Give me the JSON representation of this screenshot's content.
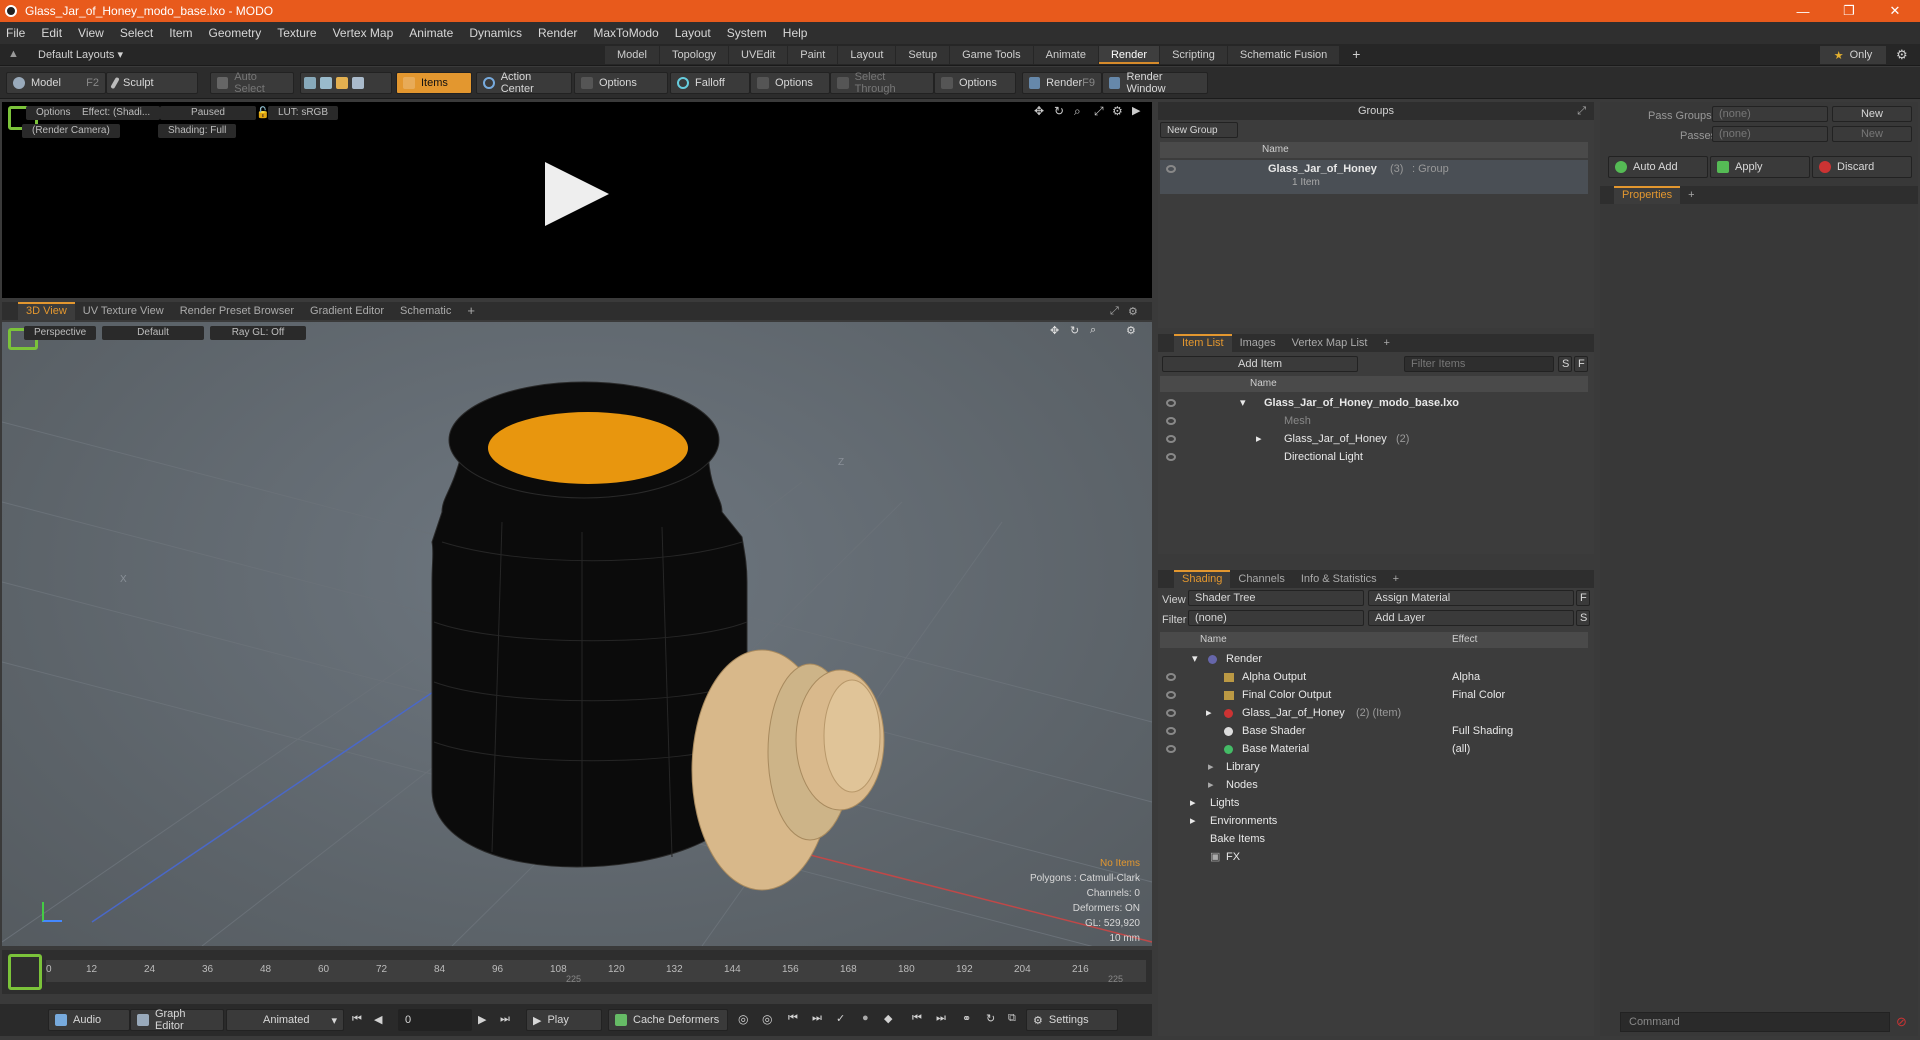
{
  "window": {
    "title": "Glass_Jar_of_Honey_modo_base.lxo - MODO"
  },
  "menu": [
    "File",
    "Edit",
    "View",
    "Select",
    "Item",
    "Geometry",
    "Texture",
    "Vertex Map",
    "Animate",
    "Dynamics",
    "Render",
    "MaxToModo",
    "Layout",
    "System",
    "Help"
  ],
  "layout": {
    "preset": "Default Layouts ▾",
    "tabs": [
      "Model",
      "Topology",
      "UVEdit",
      "Paint",
      "Layout",
      "Setup",
      "Game Tools",
      "Animate",
      "Render",
      "Scripting",
      "Schematic Fusion"
    ],
    "active_tab": "Render",
    "only_label": "Only"
  },
  "toolbar": {
    "model": "Model",
    "model_key": "F2",
    "sculpt": "Sculpt",
    "auto_select": "Auto Select",
    "items": "Items",
    "action_center": "Action Center",
    "options1": "Options",
    "falloff": "Falloff",
    "options2": "Options",
    "select_through": "Select Through",
    "options3": "Options",
    "render": "Render",
    "render_key": "F9",
    "render_window": "Render Window"
  },
  "render_view": {
    "options": "Options",
    "effect": "Effect: (Shadi...",
    "paused": "Paused",
    "lut": "LUT: sRGB",
    "camera": "(Render Camera)",
    "shading": "Shading: Full"
  },
  "viewport_tabs": [
    "3D View",
    "UV Texture View",
    "Render Preset Browser",
    "Gradient Editor",
    "Schematic"
  ],
  "viewport": {
    "perspective": "Perspective",
    "default": "Default",
    "raygl": "Ray GL: Off",
    "axis_z": "Z",
    "axis_x": "X",
    "stats": {
      "no_items": "No Items",
      "polygons": "Polygons : Catmull-Clark",
      "channels": "Channels: 0",
      "deformers": "Deformers: ON",
      "gl": "GL: 529,920",
      "size": "10 mm"
    }
  },
  "timeline": {
    "ticks": [
      "0",
      "12",
      "24",
      "36",
      "48",
      "60",
      "72",
      "84",
      "96",
      "108",
      "120",
      "132",
      "144",
      "156",
      "168",
      "180",
      "192",
      "204",
      "216"
    ],
    "mid_mark": "225",
    "end_mark": "225"
  },
  "bottombar": {
    "audio": "Audio",
    "graph_editor": "Graph Editor",
    "animated": "Animated",
    "frame": "0",
    "play": "Play",
    "cache_deformers": "Cache Deformers",
    "settings": "Settings"
  },
  "groups": {
    "title": "Groups",
    "new_group": "New Group",
    "col_name": "Name",
    "item_name": "Glass_Jar_of_Honey",
    "item_count": "(3)",
    "item_type": ": Group",
    "item_sub": "1 Item"
  },
  "passes": {
    "pass_groups_label": "Pass Groups",
    "pass_groups_value": "(none)",
    "passes_label": "Passes",
    "passes_value": "(none)",
    "new": "New",
    "new2": "New",
    "auto_add": "Auto Add",
    "apply": "Apply",
    "discard": "Discard",
    "properties_tab": "Properties"
  },
  "item_list": {
    "tabs": [
      "Item List",
      "Images",
      "Vertex Map List"
    ],
    "add_item": "Add Item",
    "filter_items": "Filter Items",
    "s": "S",
    "f": "F",
    "col_name": "Name",
    "rows": [
      {
        "label": "Glass_Jar_of_Honey_modo_base.lxo",
        "indent": 0
      },
      {
        "label": "Mesh",
        "indent": 1,
        "dim": true
      },
      {
        "label": "Glass_Jar_of_Honey",
        "count": "(2)",
        "indent": 1
      },
      {
        "label": "Directional Light",
        "indent": 1
      }
    ]
  },
  "shading": {
    "tabs": [
      "Shading",
      "Channels",
      "Info & Statistics"
    ],
    "view_label": "View",
    "view_value": "Shader Tree",
    "assign_material": "Assign Material",
    "filter_label": "Filter",
    "filter_value": "(none)",
    "add_layer": "Add Layer",
    "f": "F",
    "s": "S",
    "col_name": "Name",
    "col_effect": "Effect",
    "rows": [
      {
        "label": "Render",
        "effect": "",
        "indent": 0
      },
      {
        "label": "Alpha Output",
        "effect": "Alpha",
        "indent": 1
      },
      {
        "label": "Final Color Output",
        "effect": "Final Color",
        "indent": 1
      },
      {
        "label": "Glass_Jar_of_Honey",
        "suffix": "(2) (Item)",
        "effect": "",
        "indent": 1
      },
      {
        "label": "Base Shader",
        "effect": "Full Shading",
        "indent": 1
      },
      {
        "label": "Base Material",
        "effect": "(all)",
        "indent": 1
      },
      {
        "label": "Library",
        "effect": "",
        "indent": 1
      },
      {
        "label": "Nodes",
        "effect": "",
        "indent": 1
      },
      {
        "label": "Lights",
        "effect": "",
        "indent": 0
      },
      {
        "label": "Environments",
        "effect": "",
        "indent": 0
      },
      {
        "label": "Bake Items",
        "effect": "",
        "indent": 0
      },
      {
        "label": "FX",
        "effect": "",
        "indent": 0
      }
    ]
  },
  "command": {
    "placeholder": "Command"
  },
  "colors": {
    "accent": "#e3972f",
    "titlebar": "#e85a1c",
    "honey": "#e8960e",
    "wood": "#d8b88a"
  }
}
